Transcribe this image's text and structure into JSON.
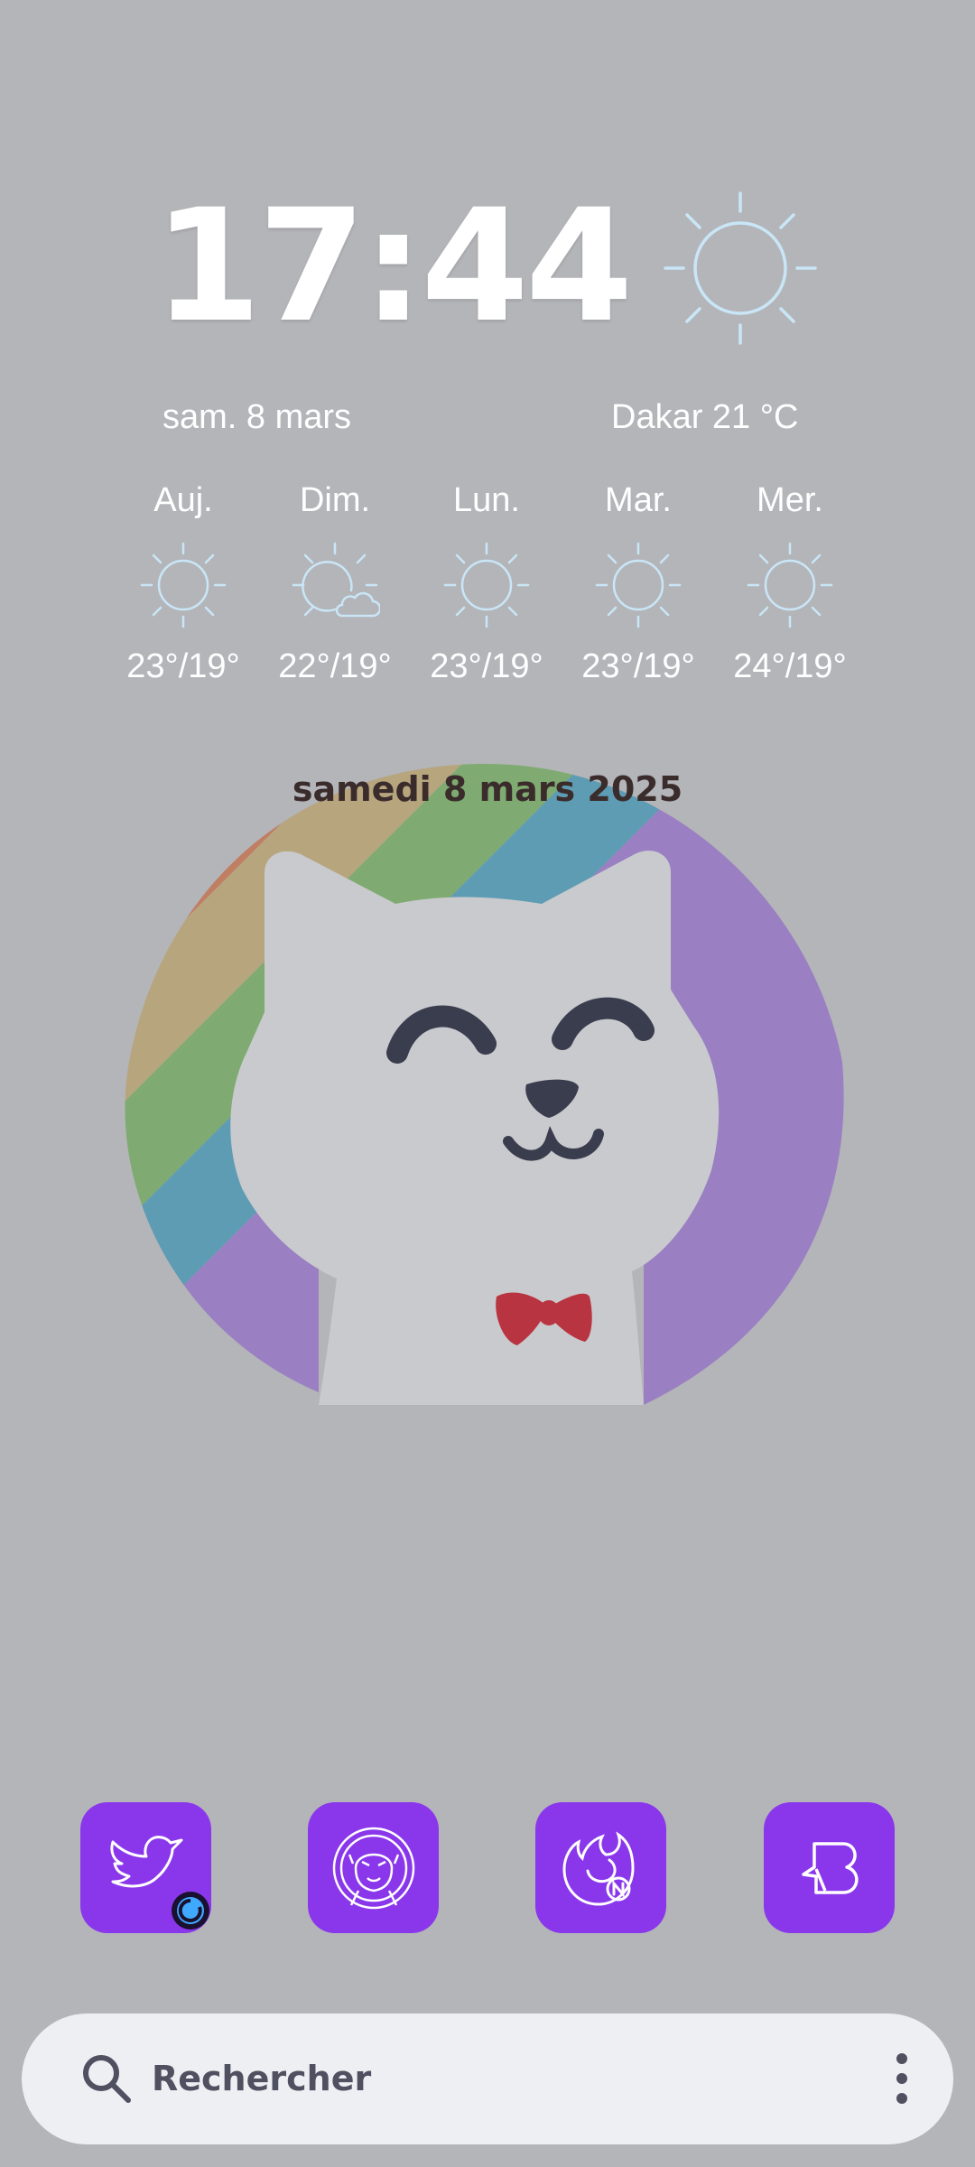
{
  "clock": {
    "time": "17:44"
  },
  "status": {
    "date": "sam. 8 mars",
    "weather": "Dakar 21 °C",
    "current_icon": "sun-icon"
  },
  "forecast": [
    {
      "day": "Auj.",
      "temps": "23°/19°",
      "icon": "sun-icon"
    },
    {
      "day": "Dim.",
      "temps": "22°/19°",
      "icon": "sun-cloud-icon"
    },
    {
      "day": "Lun.",
      "temps": "23°/19°",
      "icon": "sun-icon"
    },
    {
      "day": "Mar.",
      "temps": "23°/19°",
      "icon": "sun-icon"
    },
    {
      "day": "Mer.",
      "temps": "24°/19°",
      "icon": "sun-icon"
    }
  ],
  "widget": {
    "date": "samedi 8 mars 2025"
  },
  "dock": [
    {
      "name": "twitter",
      "icon": "bird-icon"
    },
    {
      "name": "anime-app",
      "icon": "character-icon"
    },
    {
      "name": "firefox-nightly",
      "icon": "firefox-icon"
    },
    {
      "name": "bluesky-app",
      "icon": "b-speech-icon"
    }
  ],
  "search": {
    "placeholder": "Rechercher"
  },
  "colors": {
    "background": "#b4b5b9",
    "dock_app": "#8a37ec",
    "weather_icon": "#c9e6f7",
    "search_bar": "#eeeff3"
  }
}
